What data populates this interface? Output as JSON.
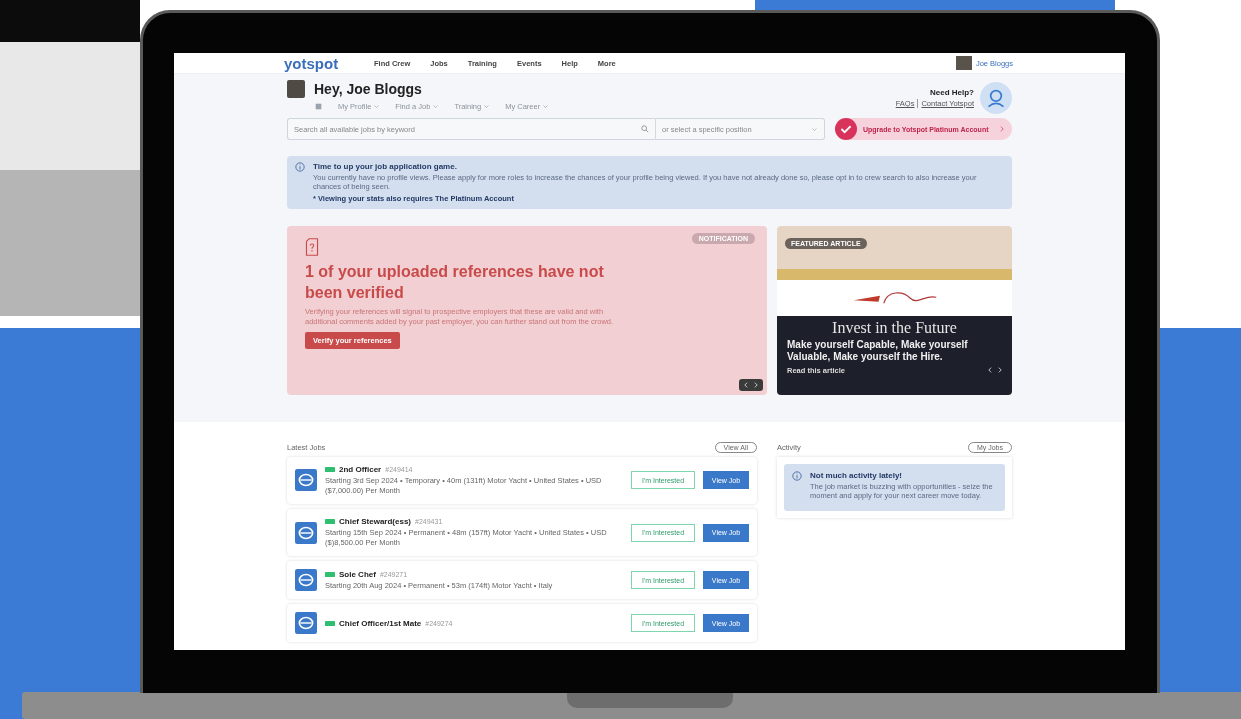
{
  "nav": {
    "logo": "yotspot",
    "links": [
      "Find Crew",
      "Jobs",
      "Training",
      "Events",
      "Help",
      "More"
    ],
    "user": "Joe Bloggs"
  },
  "greeting": "Hey, Joe Bloggs",
  "subnav": [
    "My Profile",
    "Find a Job",
    "Training",
    "My Career"
  ],
  "help": {
    "title": "Need Help?",
    "links": [
      "FAQs",
      "Contact Yotspot"
    ]
  },
  "search": {
    "placeholder": "Search all available jobs by keyword",
    "position_placeholder": "or select a specific position"
  },
  "upgrade": "Upgrade to Yotspot Platinum Account",
  "alert": {
    "title": "Time to up your job application game.",
    "text": "You currently have no profile views. Please apply for more roles to increase the chances of your profile being viewed. If you have not already done so, please opt in to crew search to also increase your chances of being seen.",
    "note": "* Viewing your stats also requires The Platinum Account"
  },
  "notification": {
    "badge": "NOTIFICATION",
    "title": "1 of your uploaded references have not been verified",
    "text": "Verifying your references will signal to prospective employers that these are valid and with additional comments added by your past employer, you can further stand out from the crowd.",
    "button": "Verify your references"
  },
  "article": {
    "badge": "FEATURED ARTICLE",
    "headline": "Invest in the Future",
    "subtitle": "Make yourself Capable, Make yourself Valuable, Make yourself the Hire.",
    "link": "Read this article"
  },
  "jobs": {
    "title": "Latest Jobs",
    "view_all": "View All",
    "items": [
      {
        "title": "2nd Officer",
        "ref": "#249414",
        "details": "Starting 3rd Sep 2024  •  Temporary  •  40m (131ft) Motor Yacht  •  United States  •  USD ($7,000.00) Per Month",
        "interested": "I'm Interested",
        "view": "View Job"
      },
      {
        "title": "Chief Steward(ess)",
        "ref": "#249431",
        "details": "Starting 15th Sep 2024  •  Permanent  •  48m (157ft) Motor Yacht  •  United States  •  USD ($)8,500.00 Per Month",
        "interested": "I'm Interested",
        "view": "View Job"
      },
      {
        "title": "Sole Chef",
        "ref": "#249271",
        "details": "Starting 20th Aug 2024  •  Permanent  •  53m (174ft) Motor Yacht  •  Italy",
        "interested": "I'm Interested",
        "view": "View Job"
      },
      {
        "title": "Chief Officer/1st Mate",
        "ref": "#249274",
        "interested": "I'm Interested",
        "view": "View Job"
      }
    ]
  },
  "activity": {
    "title": "Activity",
    "button": "My Jobs",
    "heading": "Not much activity lately!",
    "text": "The job market is buzzing with opportunities - seize the moment and apply for your next career move today."
  }
}
